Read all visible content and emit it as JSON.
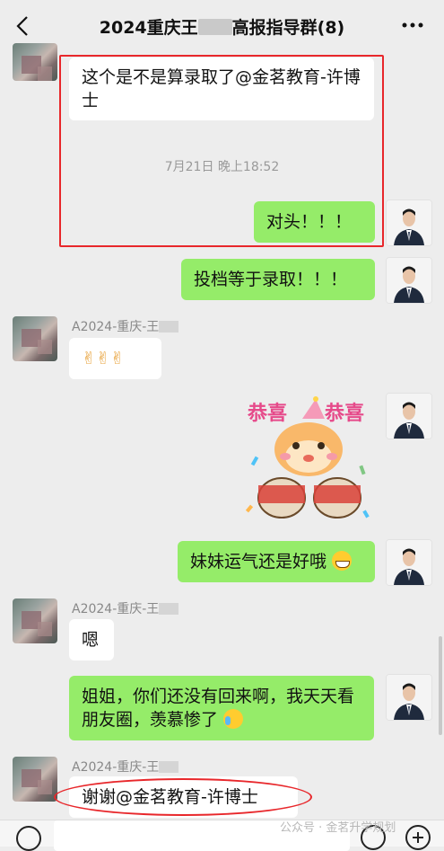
{
  "header": {
    "title_prefix": "2024重庆王",
    "title_suffix": "高报指导群(8)"
  },
  "messages": [
    {
      "text": "这个是不是算录取了@金茗教育-许博士"
    },
    {
      "text": "对头！！！"
    },
    {
      "text": "投档等于录取！！！"
    },
    {
      "sender": "A2024-重庆-王",
      "text": "✌✌✌"
    },
    {
      "sticker_text_left": "恭喜",
      "sticker_text_right": "恭喜"
    },
    {
      "text": "妹妹运气还是好哦"
    },
    {
      "sender": "A2024-重庆-王",
      "text": "嗯"
    },
    {
      "text": "姐姐，你们还没有回来啊，我天天看朋友圈，羡慕惨了"
    },
    {
      "sender": "A2024-重庆-王",
      "text": "谢谢@金茗教育-许博士"
    }
  ],
  "timestamp": "7月21日 晚上18:52",
  "watermark": "公众号 · 金茗升学规划",
  "colors": {
    "background": "#ededed",
    "green_bubble": "#95ec69",
    "white_bubble": "#ffffff",
    "annotation_red": "#e8272b"
  }
}
